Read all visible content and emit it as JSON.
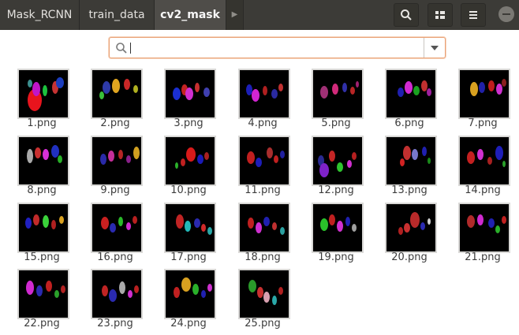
{
  "breadcrumbs": [
    {
      "label": "Mask_RCNN",
      "active": false
    },
    {
      "label": "train_data",
      "active": false
    },
    {
      "label": "cv2_mask",
      "active": true
    }
  ],
  "toolbar": {
    "search_icon": "search-icon",
    "view_icon": "grid-view-icon",
    "menu_icon": "hamburger-menu-icon",
    "minimize_icon": "minimize-icon"
  },
  "search": {
    "value": "",
    "placeholder": ""
  },
  "files": [
    {
      "name": "1.png",
      "blobs": [
        [
          "#e8141d",
          20,
          38,
          9,
          14
        ],
        [
          "#c016c9",
          22,
          24,
          5,
          9
        ],
        [
          "#1cc23d",
          33,
          26,
          3,
          7
        ],
        [
          "#c53333",
          46,
          22,
          4,
          8
        ],
        [
          "#1b3dbd",
          52,
          16,
          5,
          7
        ],
        [
          "#3c8f8f",
          14,
          17,
          3,
          5
        ]
      ]
    },
    {
      "name": "2.png",
      "blobs": [
        [
          "#2e3aa8",
          18,
          22,
          5,
          8
        ],
        [
          "#e0a520",
          30,
          20,
          5,
          9
        ],
        [
          "#c92727",
          44,
          18,
          4,
          7
        ],
        [
          "#b0b020",
          55,
          24,
          3,
          5
        ],
        [
          "#3ac03a",
          12,
          32,
          3,
          5
        ]
      ]
    },
    {
      "name": "3.png",
      "blobs": [
        [
          "#1b2fd1",
          14,
          30,
          5,
          8
        ],
        [
          "#c42323",
          24,
          25,
          4,
          7
        ],
        [
          "#d12fd1",
          30,
          30,
          5,
          8
        ],
        [
          "#c83030",
          40,
          22,
          3,
          6
        ],
        [
          "#4040b0",
          52,
          28,
          4,
          6
        ]
      ]
    },
    {
      "name": "4.png",
      "blobs": [
        [
          "#1c1fb8",
          12,
          25,
          4,
          7
        ],
        [
          "#d225d2",
          20,
          32,
          5,
          8
        ],
        [
          "#b02020",
          32,
          26,
          3,
          6
        ],
        [
          "#2a2aa0",
          44,
          30,
          4,
          6
        ],
        [
          "#c03030",
          52,
          22,
          3,
          5
        ]
      ]
    },
    {
      "name": "5.png",
      "blobs": [
        [
          "#a03075",
          14,
          28,
          5,
          8
        ],
        [
          "#d12a7a",
          28,
          24,
          4,
          7
        ],
        [
          "#3030a8",
          40,
          22,
          3,
          6
        ],
        [
          "#b82525",
          50,
          26,
          3,
          5
        ],
        [
          "#a02070",
          56,
          18,
          2,
          4
        ]
      ]
    },
    {
      "name": "6.png",
      "blobs": [
        [
          "#2020b0",
          18,
          28,
          4,
          6
        ],
        [
          "#d22ad2",
          28,
          22,
          5,
          8
        ],
        [
          "#1aa020",
          38,
          26,
          4,
          6
        ],
        [
          "#c03030",
          48,
          20,
          4,
          7
        ],
        [
          "#a020a0",
          54,
          28,
          3,
          5
        ]
      ]
    },
    {
      "name": "7.png",
      "blobs": [
        [
          "#d8a020",
          18,
          24,
          5,
          9
        ],
        [
          "#2020a8",
          28,
          22,
          4,
          7
        ],
        [
          "#c01d1d",
          40,
          20,
          4,
          7
        ],
        [
          "#d030d0",
          50,
          24,
          4,
          7
        ],
        [
          "#8a2020",
          56,
          16,
          3,
          5
        ]
      ]
    },
    {
      "name": "8.png",
      "blobs": [
        [
          "#aaaaaa",
          14,
          24,
          4,
          9
        ],
        [
          "#c83030",
          24,
          20,
          4,
          7
        ],
        [
          "#d730d7",
          34,
          22,
          4,
          7
        ],
        [
          "#2030c0",
          46,
          18,
          5,
          8
        ],
        [
          "#28b028",
          52,
          28,
          3,
          5
        ]
      ]
    },
    {
      "name": "9.png",
      "blobs": [
        [
          "#2a2aa8",
          14,
          28,
          4,
          7
        ],
        [
          "#c52f9a",
          24,
          24,
          4,
          7
        ],
        [
          "#b52525",
          36,
          22,
          3,
          6
        ],
        [
          "#d0a020",
          56,
          20,
          4,
          8
        ],
        [
          "#8a208a",
          46,
          28,
          3,
          5
        ]
      ]
    },
    {
      "name": "10.png",
      "blobs": [
        [
          "#d81a1a",
          32,
          22,
          6,
          9
        ],
        [
          "#1a1ab8",
          44,
          28,
          4,
          6
        ],
        [
          "#c02020",
          22,
          32,
          3,
          5
        ],
        [
          "#a82020",
          52,
          24,
          3,
          5
        ],
        [
          "#2ab02a",
          14,
          36,
          2,
          4
        ]
      ]
    },
    {
      "name": "11.png",
      "blobs": [
        [
          "#c01f1f",
          14,
          26,
          5,
          8
        ],
        [
          "#1d1db8",
          24,
          32,
          4,
          6
        ],
        [
          "#a82d2d",
          38,
          20,
          4,
          7
        ],
        [
          "#c02020",
          46,
          28,
          3,
          5
        ],
        [
          "#2020a0",
          54,
          22,
          3,
          5
        ]
      ]
    },
    {
      "name": "12.png",
      "blobs": [
        [
          "#2a2a90",
          10,
          30,
          4,
          7
        ],
        [
          "#7e22c8",
          14,
          42,
          6,
          9
        ],
        [
          "#c42525",
          24,
          24,
          4,
          7
        ],
        [
          "#2ec22e",
          34,
          38,
          4,
          6
        ],
        [
          "#d030d0",
          46,
          34,
          3,
          5
        ],
        [
          "#b52020",
          52,
          24,
          3,
          5
        ]
      ]
    },
    {
      "name": "13.png",
      "blobs": [
        [
          "#c23030",
          26,
          20,
          5,
          9
        ],
        [
          "#7777cc",
          36,
          22,
          4,
          7
        ],
        [
          "#2020b0",
          48,
          18,
          3,
          6
        ],
        [
          "#d22222",
          20,
          32,
          3,
          5
        ],
        [
          "#1a8a1a",
          54,
          30,
          2,
          4
        ]
      ]
    },
    {
      "name": "14.png",
      "blobs": [
        [
          "#c42020",
          14,
          26,
          5,
          8
        ],
        [
          "#d030d0",
          26,
          22,
          4,
          7
        ],
        [
          "#1e1eb8",
          50,
          20,
          5,
          9
        ],
        [
          "#a82020",
          38,
          30,
          3,
          5
        ],
        [
          "#2aa02a",
          56,
          34,
          2,
          4
        ]
      ]
    },
    {
      "name": "15.png",
      "blobs": [
        [
          "#2020c0",
          12,
          24,
          4,
          7
        ],
        [
          "#c02a2a",
          22,
          20,
          4,
          7
        ],
        [
          "#3ad23a",
          34,
          22,
          4,
          8
        ],
        [
          "#b02020",
          44,
          26,
          3,
          6
        ],
        [
          "#d8a020",
          54,
          20,
          3,
          5
        ]
      ]
    },
    {
      "name": "16.png",
      "blobs": [
        [
          "#c82020",
          16,
          24,
          5,
          8
        ],
        [
          "#2a2ab0",
          26,
          30,
          4,
          6
        ],
        [
          "#2ab82a",
          36,
          22,
          3,
          6
        ],
        [
          "#d02ad0",
          46,
          28,
          3,
          5
        ],
        [
          "#b82020",
          54,
          20,
          3,
          5
        ]
      ]
    },
    {
      "name": "17.png",
      "blobs": [
        [
          "#c02424",
          18,
          22,
          5,
          9
        ],
        [
          "#22b8b8",
          28,
          28,
          4,
          7
        ],
        [
          "#2a2ab0",
          40,
          24,
          4,
          6
        ],
        [
          "#d02a2a",
          48,
          30,
          3,
          5
        ],
        [
          "#2aa8a8",
          56,
          34,
          3,
          5
        ]
      ]
    },
    {
      "name": "18.png",
      "blobs": [
        [
          "#c02020",
          14,
          24,
          4,
          7
        ],
        [
          "#d030d0",
          24,
          30,
          4,
          7
        ],
        [
          "#2020b0",
          34,
          22,
          4,
          6
        ],
        [
          "#c03030",
          44,
          28,
          3,
          5
        ],
        [
          "#2aa0a0",
          54,
          34,
          3,
          5
        ]
      ]
    },
    {
      "name": "19.png",
      "blobs": [
        [
          "#2ac02a",
          14,
          26,
          5,
          8
        ],
        [
          "#c02020",
          24,
          20,
          4,
          7
        ],
        [
          "#d030d0",
          34,
          28,
          4,
          7
        ],
        [
          "#2020b0",
          44,
          22,
          3,
          6
        ],
        [
          "#a0a0a0",
          52,
          30,
          3,
          5
        ]
      ]
    },
    {
      "name": "20.png",
      "blobs": [
        [
          "#b82a2a",
          36,
          20,
          6,
          10
        ],
        [
          "#c83030",
          26,
          30,
          4,
          6
        ],
        [
          "#2a2ab0",
          46,
          28,
          3,
          5
        ],
        [
          "#b02020",
          18,
          34,
          3,
          5
        ],
        [
          "#d0d0d0",
          54,
          22,
          2,
          4
        ]
      ]
    },
    {
      "name": "21.png",
      "blobs": [
        [
          "#b02a2a",
          14,
          22,
          5,
          8
        ],
        [
          "#d02ad0",
          26,
          20,
          4,
          7
        ],
        [
          "#2020b0",
          40,
          24,
          4,
          6
        ],
        [
          "#2ab02a",
          48,
          32,
          3,
          5
        ],
        [
          "#c02020",
          56,
          20,
          3,
          5
        ]
      ]
    },
    {
      "name": "22.png",
      "blobs": [
        [
          "#d02ad0",
          14,
          22,
          5,
          9
        ],
        [
          "#2a2ab0",
          26,
          26,
          4,
          7
        ],
        [
          "#c02020",
          38,
          20,
          4,
          7
        ],
        [
          "#2aa02a",
          48,
          30,
          3,
          5
        ],
        [
          "#b02020",
          56,
          24,
          3,
          5
        ]
      ]
    },
    {
      "name": "23.png",
      "blobs": [
        [
          "#c02424",
          16,
          26,
          4,
          7
        ],
        [
          "#2a2ab0",
          26,
          32,
          5,
          8
        ],
        [
          "#aaaaaa",
          38,
          22,
          4,
          8
        ],
        [
          "#d030d0",
          48,
          30,
          3,
          5
        ],
        [
          "#b82020",
          56,
          24,
          3,
          5
        ]
      ]
    },
    {
      "name": "24.png",
      "blobs": [
        [
          "#c02020",
          14,
          28,
          4,
          7
        ],
        [
          "#d8a020",
          26,
          18,
          6,
          9
        ],
        [
          "#2ab02a",
          38,
          24,
          4,
          7
        ],
        [
          "#2020b0",
          48,
          30,
          3,
          5
        ],
        [
          "#d030d0",
          56,
          22,
          3,
          5
        ]
      ]
    },
    {
      "name": "25.png",
      "blobs": [
        [
          "#2a9a2a",
          16,
          20,
          5,
          8
        ],
        [
          "#c83030",
          26,
          28,
          4,
          7
        ],
        [
          "#d8a0b0",
          34,
          34,
          4,
          7
        ],
        [
          "#2aa8a8",
          44,
          38,
          3,
          6
        ],
        [
          "#b02020",
          52,
          26,
          3,
          5
        ]
      ]
    }
  ]
}
